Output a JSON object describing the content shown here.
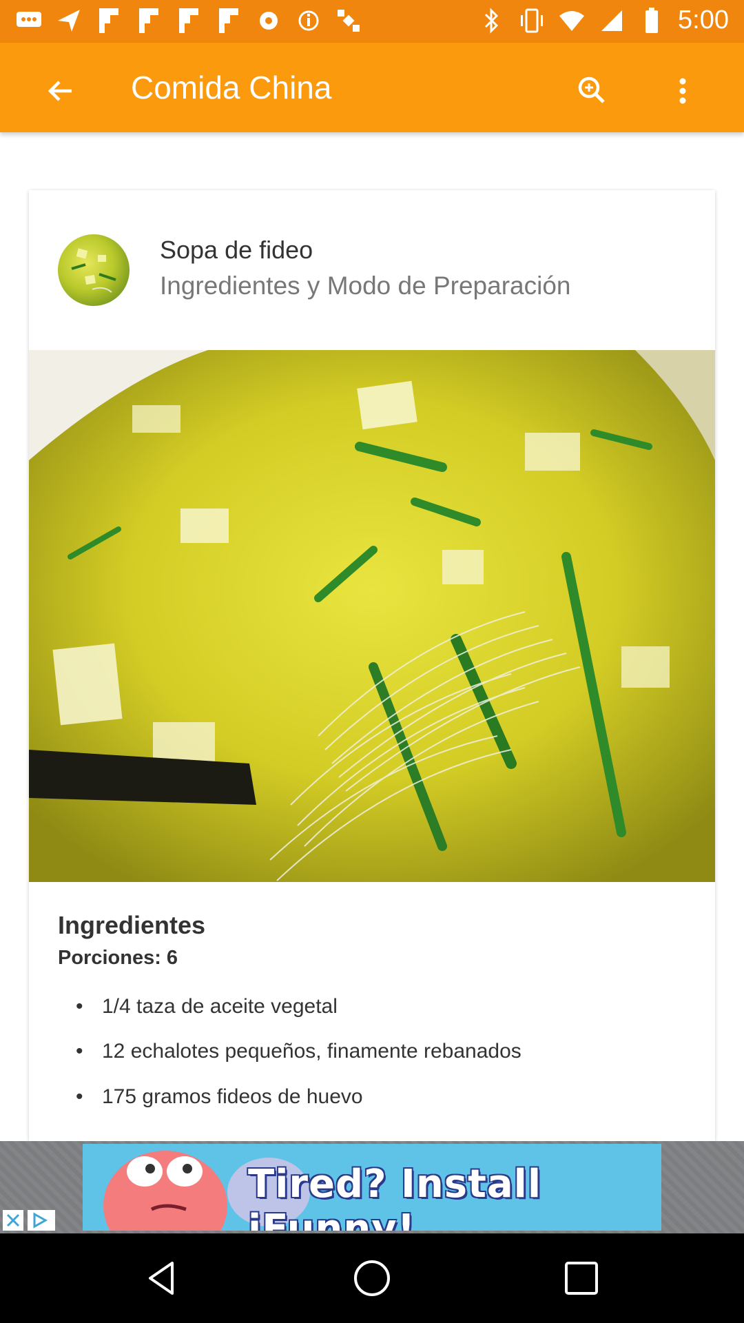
{
  "status_bar": {
    "time": "5:00",
    "icons_left": [
      "message-icon",
      "send-icon",
      "flipboard-icon",
      "flipboard-icon",
      "flipboard-icon",
      "flipboard-icon",
      "radio-icon",
      "info-icon",
      "satellite-icon"
    ],
    "icons_right": [
      "bluetooth-icon",
      "vibrate-icon",
      "wifi-icon",
      "signal-icon",
      "battery-icon"
    ]
  },
  "app_bar": {
    "title": "Comida China",
    "back_icon": "back-arrow-icon",
    "search_icon": "search-icon",
    "more_icon": "more-vert-icon"
  },
  "recipe": {
    "title": "Sopa de fideo",
    "subtitle": "Ingredientes y Modo de Preparación",
    "image_alt": "soup-photo",
    "ingredients_heading": "Ingredientes",
    "portions": "Porciones: 6",
    "ingredients": [
      "1/4 taza de aceite vegetal",
      "12 echalotes pequeños, finamente rebanados",
      "175 gramos fideos de huevo"
    ]
  },
  "ad": {
    "text": "Tired? Install iFunny!"
  },
  "colors": {
    "status_bar": "#f0860d",
    "app_bar": "#fb9a0d",
    "ad_bg": "#5fc3e8"
  }
}
